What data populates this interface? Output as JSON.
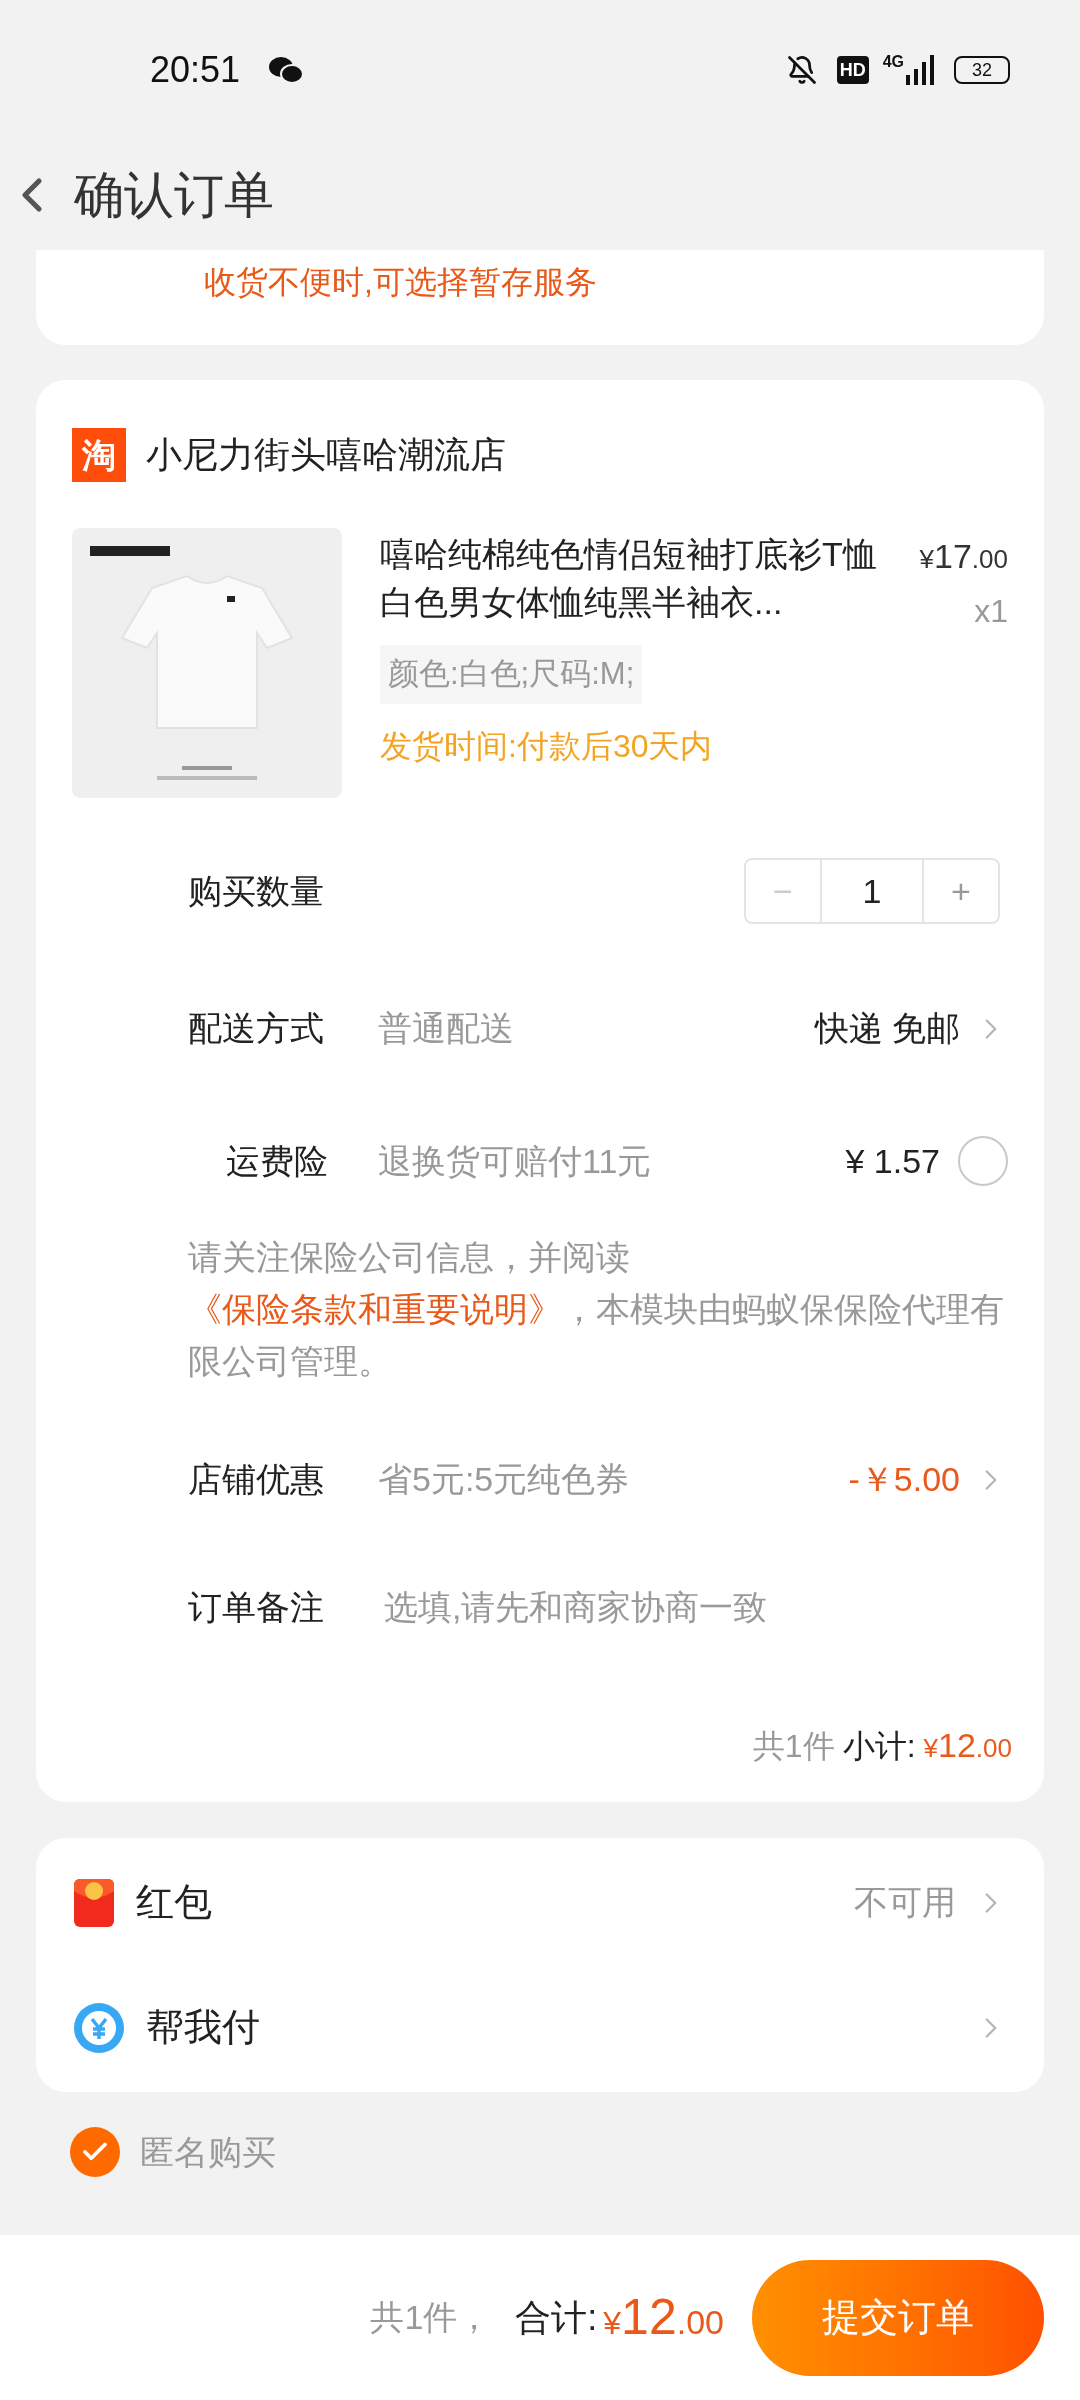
{
  "status_bar": {
    "time": "20:51",
    "hd": "HD",
    "network": "4G",
    "battery": "32"
  },
  "header": {
    "title": "确认订单"
  },
  "storage_notice": "收货不便时,可选择暂存服务",
  "shop": {
    "logo": "淘",
    "name": "小尼力街头嘻哈潮流店"
  },
  "product": {
    "title": "嘻哈纯棉纯色情侣短袖打底衫T恤白色男女体恤纯黑半袖衣...",
    "currency": "¥",
    "price": "17",
    "decimals": ".00",
    "quantity": "x1",
    "spec": "颜色:白色;尺码:M;",
    "ship_time": "发货时间:付款后30天内"
  },
  "quantity_row": {
    "label": "购买数量",
    "minus": {
      "text": "−",
      "disabled": true
    },
    "value": "1",
    "plus": {
      "text": "+",
      "disabled": false
    }
  },
  "delivery_row": {
    "label": "配送方式",
    "detail": "普通配送",
    "value": "快递 免邮"
  },
  "insurance_row": {
    "label": "运费险",
    "detail": "退换货可赔付11元",
    "price": "¥ 1.57",
    "checked": false
  },
  "insurance_note": {
    "before": "请关注保险公司信息，并阅读",
    "link": "《保险条款和重要说明》",
    "after": "，本模块由蚂蚁保保险代理有限公司管理。"
  },
  "discount_row": {
    "label": "店铺优惠",
    "detail": "省5元:5元纯色券",
    "value": "-￥5.00"
  },
  "remark_row": {
    "label": "订单备注",
    "placeholder": "选填,请先和商家协商一致"
  },
  "subtotal": {
    "count": "共1件",
    "label": "小计:",
    "currency": "¥",
    "amount": "12",
    "decimals": ".00"
  },
  "extras": [
    {
      "kind": "red-packet",
      "label": "红包",
      "value": "不可用"
    },
    {
      "kind": "pay-for-me",
      "label": "帮我付"
    }
  ],
  "anonymous": {
    "label": "匿名购买",
    "checked": true
  },
  "footer": {
    "count": "共1件，",
    "label": "合计:",
    "currency": "¥",
    "amount": "12",
    "decimals": ".00",
    "button": "提交订单"
  }
}
